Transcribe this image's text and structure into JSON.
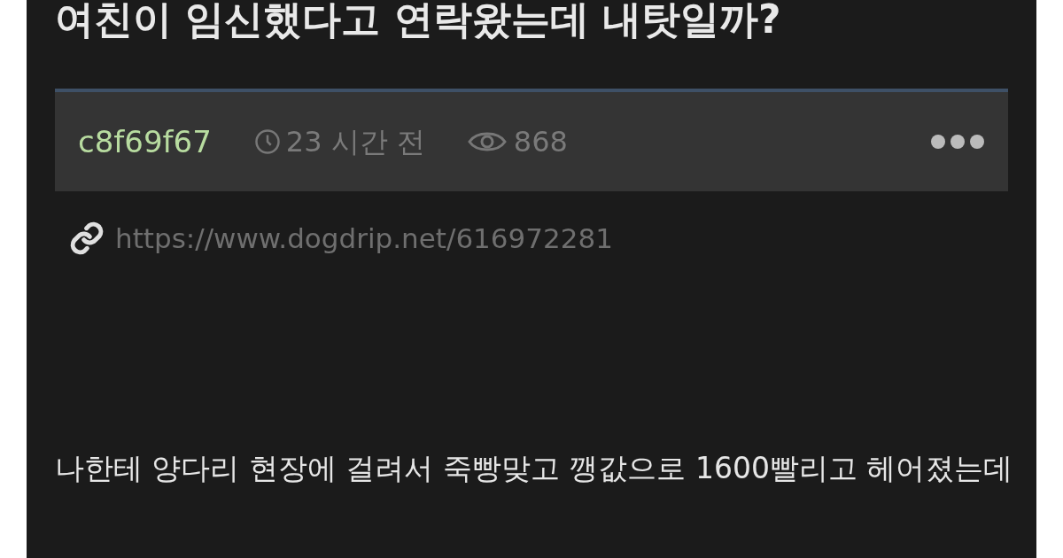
{
  "post": {
    "title": "여친이 임신했다고 연락왔는데 내탓일까?",
    "meta": {
      "author": "c8f69f67",
      "time": "23 시간 전",
      "views": "868"
    },
    "link": "https://www.dogdrip.net/616972281",
    "body": "나한테 양다리 현장에 걸려서 죽빵맞고 깽값으로 1600빨리고 헤어졌는데"
  }
}
